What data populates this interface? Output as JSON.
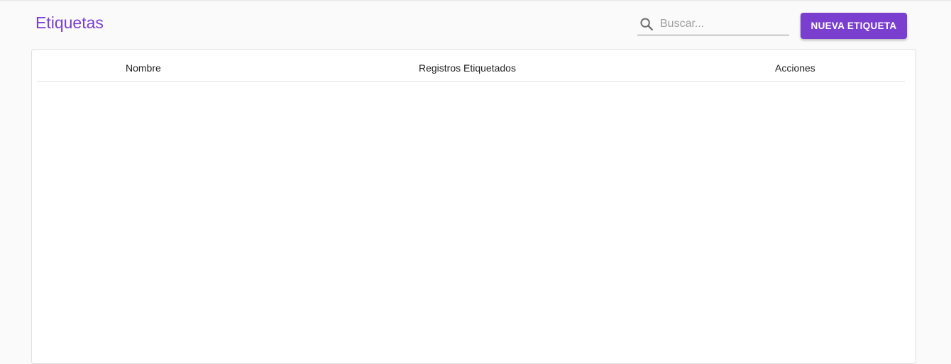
{
  "page": {
    "title": "Etiquetas"
  },
  "search": {
    "placeholder": "Buscar...",
    "value": "",
    "icon": "search-icon"
  },
  "actions": {
    "new_label": "NUEVA ETIQUETA"
  },
  "table": {
    "columns": [
      "Nombre",
      "Registros Etiquetados",
      "Acciones"
    ],
    "rows": []
  },
  "colors": {
    "accent": "#7b3fd0",
    "background": "#fafafa",
    "card": "#ffffff",
    "border": "#e0e0e0"
  }
}
